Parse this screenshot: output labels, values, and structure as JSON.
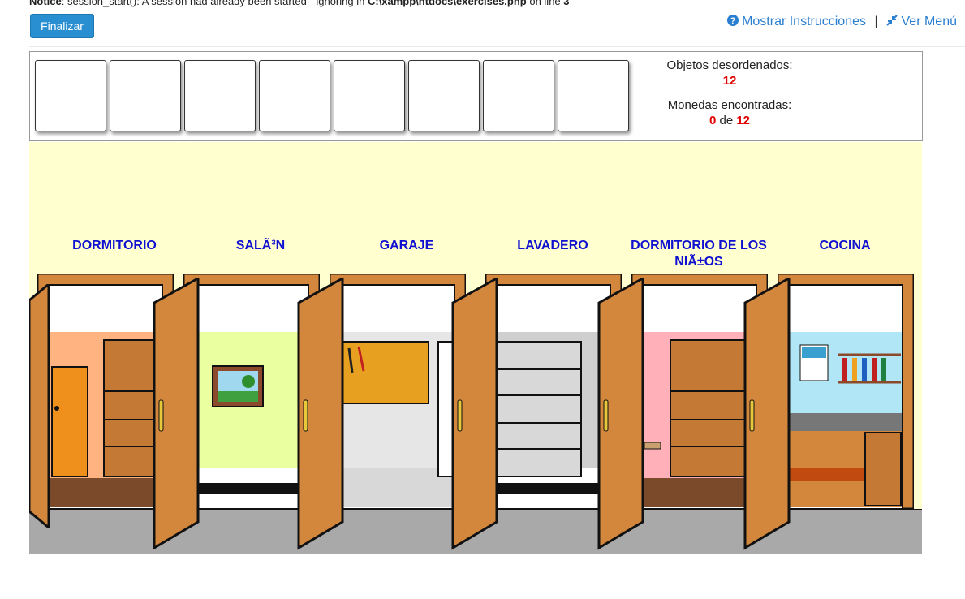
{
  "notice": {
    "label": "Notice",
    "message": ": session_start(): A session had already been started - ignoring in ",
    "path": "C:\\xampp\\htdocs\\exercises.php",
    "line_text": " on line ",
    "line_number": "3"
  },
  "toolbar": {
    "finish_label": "Finalizar",
    "instructions_label": "Mostrar Instrucciones",
    "separator": "|",
    "menu_label": "Ver Menú"
  },
  "inventory": {
    "slot_count": 8,
    "unordered_label": "Objetos desordenados:",
    "unordered_count": "12",
    "coins_label": "Monedas encontradas:",
    "coins_found": "0",
    "coins_of": "de",
    "coins_total": "12"
  },
  "rooms": [
    {
      "label": "DORMITORIO",
      "wall_color": "#ffb380",
      "floor_color": "#7a4a2a"
    },
    {
      "label": "SALÃ³N",
      "wall_color": "#eaffa0",
      "floor_color": "#ffffff"
    },
    {
      "label": "GARAJE",
      "wall_color": "#e6e6e6",
      "floor_color": "#d8d8d8"
    },
    {
      "label": "LAVADERO",
      "wall_color": "#cfcfcf",
      "floor_color": "#ffffff"
    },
    {
      "label": "DORMITORIO DE LOS NIÃ±OS",
      "wall_color": "#ffb0b8",
      "floor_color": "#7a4a2a"
    },
    {
      "label": "COCINA",
      "wall_color": "#b0e6f5",
      "floor_color": "#7a4a2a"
    }
  ],
  "colors": {
    "door": "#d2873d",
    "accent_blue": "#2a8fd0",
    "label_blue": "#1010d0",
    "count_red": "#e00000",
    "scene_bg": "#ffffd0"
  },
  "icons": {
    "instructions": "question-circle-icon",
    "menu": "compress-arrows-icon"
  }
}
